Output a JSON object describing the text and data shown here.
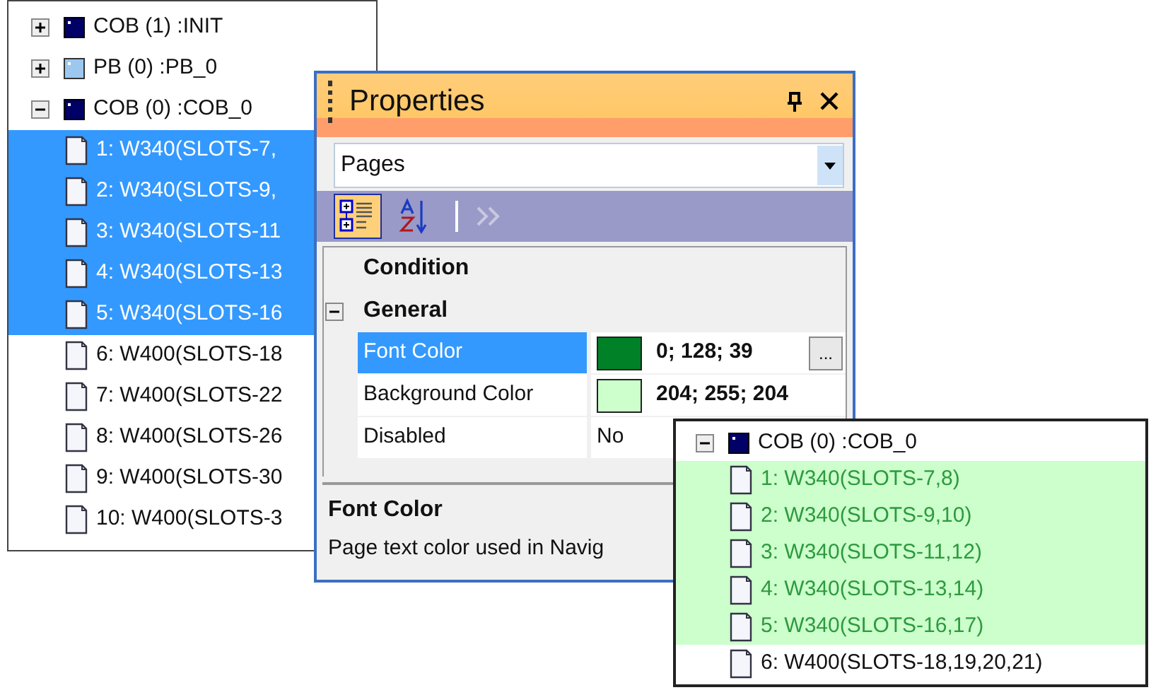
{
  "tree": [
    {
      "label": "COB (1) :INIT",
      "kind": "cob",
      "expanded": false
    },
    {
      "label": "PB (0) :PB_0",
      "kind": "pb",
      "expanded": false
    },
    {
      "label": "COB (0) :COB_0",
      "kind": "cob",
      "expanded": true,
      "children": [
        {
          "label": "1: W340(SLOTS-7,",
          "kind": "page",
          "selected": true
        },
        {
          "label": "2: W340(SLOTS-9,",
          "kind": "page",
          "selected": true
        },
        {
          "label": "3: W340(SLOTS-11",
          "kind": "page",
          "selected": true
        },
        {
          "label": "4: W340(SLOTS-13",
          "kind": "page",
          "selected": true
        },
        {
          "label": "5: W340(SLOTS-16",
          "kind": "page",
          "selected": true
        },
        {
          "label": "6: W400(SLOTS-18",
          "kind": "page",
          "selected": false
        },
        {
          "label": "7: W400(SLOTS-22",
          "kind": "page",
          "selected": false
        },
        {
          "label": "8: W400(SLOTS-26",
          "kind": "page",
          "selected": false
        },
        {
          "label": "9: W400(SLOTS-30",
          "kind": "page",
          "selected": false
        },
        {
          "label": "10: W400(SLOTS-3",
          "kind": "page",
          "selected": false
        }
      ]
    }
  ],
  "properties": {
    "title": "Properties",
    "object_combo": {
      "value": "Pages"
    },
    "toolbar": [
      {
        "kind": "categorized",
        "selected": true
      },
      {
        "kind": "alphabetical",
        "selected": false
      }
    ],
    "categories": [
      {
        "name": "Condition"
      },
      {
        "name": "General",
        "expanded": true,
        "properties": [
          {
            "name": "Font Color",
            "value": "0; 128; 39",
            "color": "#008027",
            "modified": true,
            "selected": true,
            "button": "..."
          },
          {
            "name": "Background Color",
            "value": "204; 255; 204",
            "color": "#ccffcc",
            "modified": true,
            "selected": false
          },
          {
            "name": "Disabled",
            "value": "No",
            "modified": false,
            "selected": false
          }
        ]
      }
    ],
    "description": {
      "title": "Font Color",
      "text": "Page text color used in Navig"
    }
  },
  "preview_tree": {
    "label": "COB (0) :COB_0",
    "kind": "cob",
    "expanded": true,
    "children": [
      {
        "label": "1: W340(SLOTS-7,8)",
        "kind": "page",
        "styled": true
      },
      {
        "label": "2: W340(SLOTS-9,10)",
        "kind": "page",
        "styled": true
      },
      {
        "label": "3: W340(SLOTS-11,12)",
        "kind": "page",
        "styled": true
      },
      {
        "label": "4: W340(SLOTS-13,14)",
        "kind": "page",
        "styled": true
      },
      {
        "label": "5: W340(SLOTS-16,17)",
        "kind": "page",
        "styled": true
      },
      {
        "label": "6: W400(SLOTS-18,19,20,21)",
        "kind": "page",
        "styled": false
      }
    ]
  }
}
